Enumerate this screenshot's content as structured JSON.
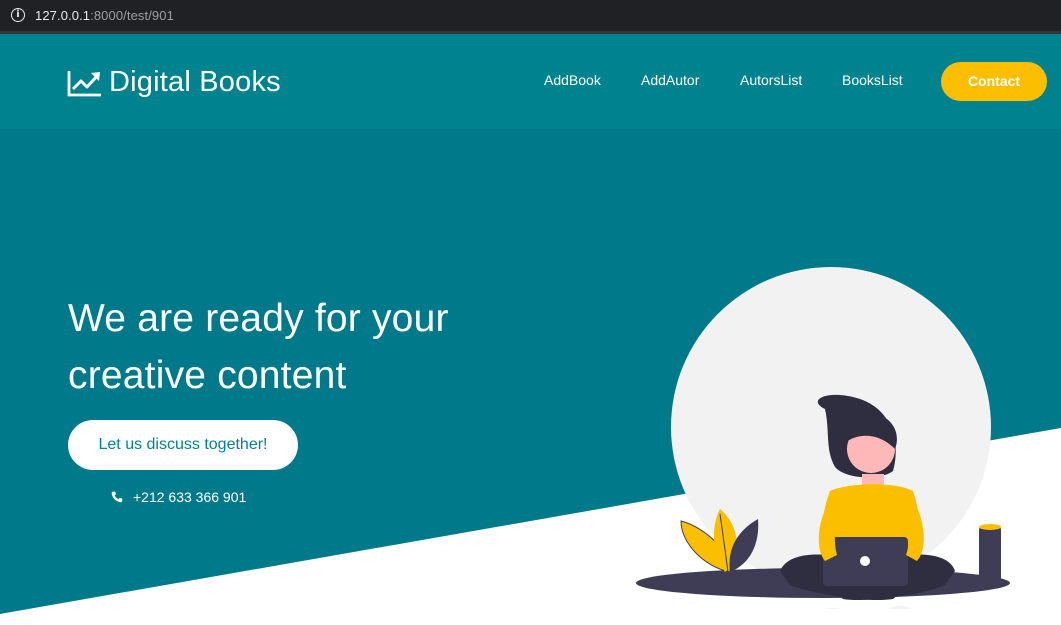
{
  "browser": {
    "url_host": "127.0.0.1",
    "url_path": ":8000/test/901"
  },
  "header": {
    "logo_text": "Digital Books",
    "logo_icon": "trending-chart-icon",
    "nav": [
      "AddBook",
      "AddAutor",
      "AutorsList",
      "BooksList"
    ],
    "contact_label": "Contact"
  },
  "hero": {
    "title_line1": "We are ready for your",
    "title_line2": "creative content",
    "cta_label": "Let us discuss together!",
    "phone": "+212 633 366 901",
    "phone_icon": "phone-icon",
    "illustration": "woman-with-laptop-illustration"
  },
  "colors": {
    "teal_header": "#00838f",
    "teal_hero": "#007a8a",
    "accent_yellow": "#fbbf00",
    "white": "#ffffff",
    "dark": "#3f3d56"
  }
}
